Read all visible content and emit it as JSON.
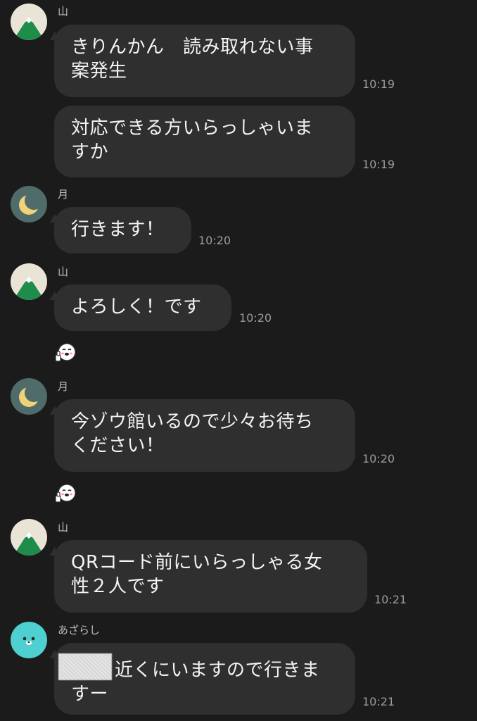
{
  "contacts": {
    "yama": {
      "name": "山",
      "icon": "mountain-avatar-icon"
    },
    "tsuki": {
      "name": "月",
      "icon": "crescent-moon-avatar-icon"
    },
    "azarashi": {
      "name": "あざらし",
      "icon": "seal-avatar-icon"
    }
  },
  "messages": [
    {
      "sender": "yama",
      "lines": [
        "きりんかん　読み取れない事",
        "案発生"
      ],
      "time": "10:19"
    },
    {
      "sender": "yama",
      "lines": [
        "対応できる方いらっしゃいま",
        "すか"
      ],
      "time": "10:19"
    },
    {
      "sender": "tsuki",
      "lines": [
        "行きます！"
      ],
      "time": "10:20"
    },
    {
      "sender": "yama",
      "lines": [
        "よろしく！です"
      ],
      "time": "10:20",
      "reaction": "thumbs-up-face-icon"
    },
    {
      "sender": "tsuki",
      "lines": [
        "今ゾウ館いるので少々お待ち",
        "ください！"
      ],
      "time": "10:20",
      "reaction": "thumbs-up-face-icon"
    },
    {
      "sender": "yama",
      "lines": [
        "QRコード前にいらっしゃる女",
        "性２人です"
      ],
      "time": "10:21"
    },
    {
      "sender": "azarashi",
      "lines": [
        "近くにいますので行きま",
        "すー"
      ],
      "time": "10:21",
      "redacted_prefix": true
    }
  ],
  "colors": {
    "background": "#1b1b1b",
    "bubble": "#2f2f2f",
    "text": "#f4f4f4",
    "time": "#9c9c9c"
  }
}
